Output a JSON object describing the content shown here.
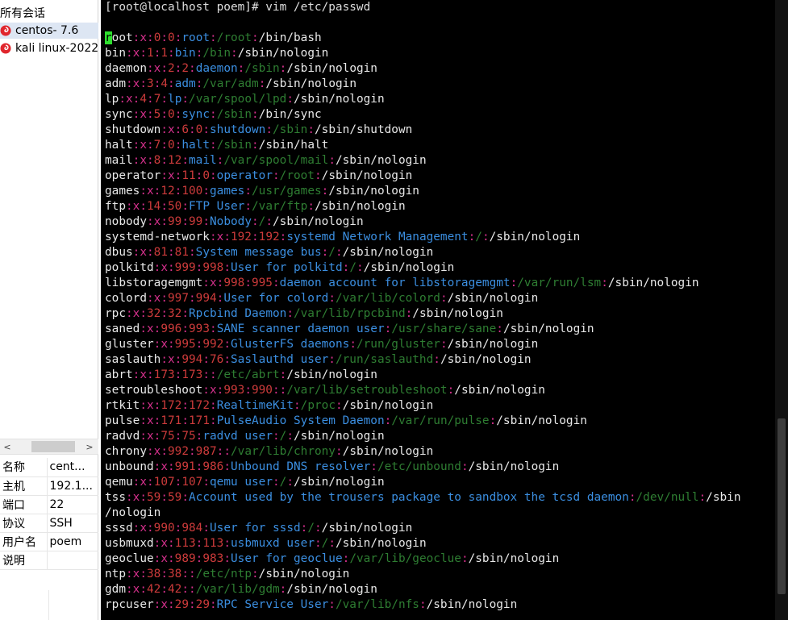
{
  "sidebar": {
    "title": "所有会话",
    "sessions": [
      {
        "label": "centos- 7.6",
        "selected": true,
        "icon": "session-swirl-icon"
      },
      {
        "label": "kali linux-2022",
        "selected": false,
        "icon": "session-swirl-icon"
      }
    ],
    "scroll_left": "<",
    "scroll_right": ">",
    "properties": [
      {
        "key": "名称",
        "value": "cent..."
      },
      {
        "key": "主机",
        "value": "192.1..."
      },
      {
        "key": "端口",
        "value": "22"
      },
      {
        "key": "协议",
        "value": "SSH"
      },
      {
        "key": "用户名",
        "value": "poem"
      },
      {
        "key": "说明",
        "value": ""
      }
    ]
  },
  "terminal": {
    "prompt": "[root@localhost poem]# vim /etc/passwd",
    "entries": [
      {
        "user": "root",
        "pw": "x",
        "uid": "0",
        "gid": "0",
        "gecos": "root",
        "home": "/root",
        "shell": "/bin/bash"
      },
      {
        "user": "bin",
        "pw": "x",
        "uid": "1",
        "gid": "1",
        "gecos": "bin",
        "home": "/bin",
        "shell": "/sbin/nologin"
      },
      {
        "user": "daemon",
        "pw": "x",
        "uid": "2",
        "gid": "2",
        "gecos": "daemon",
        "home": "/sbin",
        "shell": "/sbin/nologin"
      },
      {
        "user": "adm",
        "pw": "x",
        "uid": "3",
        "gid": "4",
        "gecos": "adm",
        "home": "/var/adm",
        "shell": "/sbin/nologin"
      },
      {
        "user": "lp",
        "pw": "x",
        "uid": "4",
        "gid": "7",
        "gecos": "lp",
        "home": "/var/spool/lpd",
        "shell": "/sbin/nologin"
      },
      {
        "user": "sync",
        "pw": "x",
        "uid": "5",
        "gid": "0",
        "gecos": "sync",
        "home": "/sbin",
        "shell": "/bin/sync"
      },
      {
        "user": "shutdown",
        "pw": "x",
        "uid": "6",
        "gid": "0",
        "gecos": "shutdown",
        "home": "/sbin",
        "shell": "/sbin/shutdown"
      },
      {
        "user": "halt",
        "pw": "x",
        "uid": "7",
        "gid": "0",
        "gecos": "halt",
        "home": "/sbin",
        "shell": "/sbin/halt"
      },
      {
        "user": "mail",
        "pw": "x",
        "uid": "8",
        "gid": "12",
        "gecos": "mail",
        "home": "/var/spool/mail",
        "shell": "/sbin/nologin"
      },
      {
        "user": "operator",
        "pw": "x",
        "uid": "11",
        "gid": "0",
        "gecos": "operator",
        "home": "/root",
        "shell": "/sbin/nologin"
      },
      {
        "user": "games",
        "pw": "x",
        "uid": "12",
        "gid": "100",
        "gecos": "games",
        "home": "/usr/games",
        "shell": "/sbin/nologin"
      },
      {
        "user": "ftp",
        "pw": "x",
        "uid": "14",
        "gid": "50",
        "gecos": "FTP User",
        "home": "/var/ftp",
        "shell": "/sbin/nologin"
      },
      {
        "user": "nobody",
        "pw": "x",
        "uid": "99",
        "gid": "99",
        "gecos": "Nobody",
        "home": "/",
        "shell": "/sbin/nologin"
      },
      {
        "user": "systemd-network",
        "pw": "x",
        "uid": "192",
        "gid": "192",
        "gecos": "systemd Network Management",
        "home": "/",
        "shell": "/sbin/nologin"
      },
      {
        "user": "dbus",
        "pw": "x",
        "uid": "81",
        "gid": "81",
        "gecos": "System message bus",
        "home": "/",
        "shell": "/sbin/nologin"
      },
      {
        "user": "polkitd",
        "pw": "x",
        "uid": "999",
        "gid": "998",
        "gecos": "User for polkitd",
        "home": "/",
        "shell": "/sbin/nologin"
      },
      {
        "user": "libstoragemgmt",
        "pw": "x",
        "uid": "998",
        "gid": "995",
        "gecos": "daemon account for libstoragemgmt",
        "home": "/var/run/lsm",
        "shell": "/sbin/nologin"
      },
      {
        "user": "colord",
        "pw": "x",
        "uid": "997",
        "gid": "994",
        "gecos": "User for colord",
        "home": "/var/lib/colord",
        "shell": "/sbin/nologin"
      },
      {
        "user": "rpc",
        "pw": "x",
        "uid": "32",
        "gid": "32",
        "gecos": "Rpcbind Daemon",
        "home": "/var/lib/rpcbind",
        "shell": "/sbin/nologin"
      },
      {
        "user": "saned",
        "pw": "x",
        "uid": "996",
        "gid": "993",
        "gecos": "SANE scanner daemon user",
        "home": "/usr/share/sane",
        "shell": "/sbin/nologin"
      },
      {
        "user": "gluster",
        "pw": "x",
        "uid": "995",
        "gid": "992",
        "gecos": "GlusterFS daemons",
        "home": "/run/gluster",
        "shell": "/sbin/nologin"
      },
      {
        "user": "saslauth",
        "pw": "x",
        "uid": "994",
        "gid": "76",
        "gecos": "Saslauthd user",
        "home": "/run/saslauthd",
        "shell": "/sbin/nologin"
      },
      {
        "user": "abrt",
        "pw": "x",
        "uid": "173",
        "gid": "173",
        "gecos": "",
        "home": "/etc/abrt",
        "shell": "/sbin/nologin"
      },
      {
        "user": "setroubleshoot",
        "pw": "x",
        "uid": "993",
        "gid": "990",
        "gecos": "",
        "home": "/var/lib/setroubleshoot",
        "shell": "/sbin/nologin"
      },
      {
        "user": "rtkit",
        "pw": "x",
        "uid": "172",
        "gid": "172",
        "gecos": "RealtimeKit",
        "home": "/proc",
        "shell": "/sbin/nologin"
      },
      {
        "user": "pulse",
        "pw": "x",
        "uid": "171",
        "gid": "171",
        "gecos": "PulseAudio System Daemon",
        "home": "/var/run/pulse",
        "shell": "/sbin/nologin"
      },
      {
        "user": "radvd",
        "pw": "x",
        "uid": "75",
        "gid": "75",
        "gecos": "radvd user",
        "home": "/",
        "shell": "/sbin/nologin"
      },
      {
        "user": "chrony",
        "pw": "x",
        "uid": "992",
        "gid": "987",
        "gecos": "",
        "home": "/var/lib/chrony",
        "shell": "/sbin/nologin"
      },
      {
        "user": "unbound",
        "pw": "x",
        "uid": "991",
        "gid": "986",
        "gecos": "Unbound DNS resolver",
        "home": "/etc/unbound",
        "shell": "/sbin/nologin"
      },
      {
        "user": "qemu",
        "pw": "x",
        "uid": "107",
        "gid": "107",
        "gecos": "qemu user",
        "home": "/",
        "shell": "/sbin/nologin"
      },
      {
        "user": "tss",
        "pw": "x",
        "uid": "59",
        "gid": "59",
        "gecos": "Account used by the trousers package to sandbox the tcsd daemon",
        "home": "/dev/null",
        "shell": "/sbin/nologin",
        "wrap_at": "/sbin"
      },
      {
        "user": "sssd",
        "pw": "x",
        "uid": "990",
        "gid": "984",
        "gecos": "User for sssd",
        "home": "/",
        "shell": "/sbin/nologin"
      },
      {
        "user": "usbmuxd",
        "pw": "x",
        "uid": "113",
        "gid": "113",
        "gecos": "usbmuxd user",
        "home": "/",
        "shell": "/sbin/nologin"
      },
      {
        "user": "geoclue",
        "pw": "x",
        "uid": "989",
        "gid": "983",
        "gecos": "User for geoclue",
        "home": "/var/lib/geoclue",
        "shell": "/sbin/nologin"
      },
      {
        "user": "ntp",
        "pw": "x",
        "uid": "38",
        "gid": "38",
        "gecos": "",
        "home": "/etc/ntp",
        "shell": "/sbin/nologin"
      },
      {
        "user": "gdm",
        "pw": "x",
        "uid": "42",
        "gid": "42",
        "gecos": "",
        "home": "/var/lib/gdm",
        "shell": "/sbin/nologin"
      },
      {
        "user": "rpcuser",
        "pw": "x",
        "uid": "29",
        "gid": "29",
        "gecos": "RPC Service User",
        "home": "/var/lib/nfs",
        "shell": "/sbin/nologin"
      }
    ],
    "colors": {
      "background": "#000000",
      "cursor": "#2ee02e",
      "separator": "#d5308c",
      "number": "#cd3b3b",
      "gecos": "#3b8ee0",
      "home": "#2e7d32",
      "shell": "#e8e8e8"
    }
  }
}
